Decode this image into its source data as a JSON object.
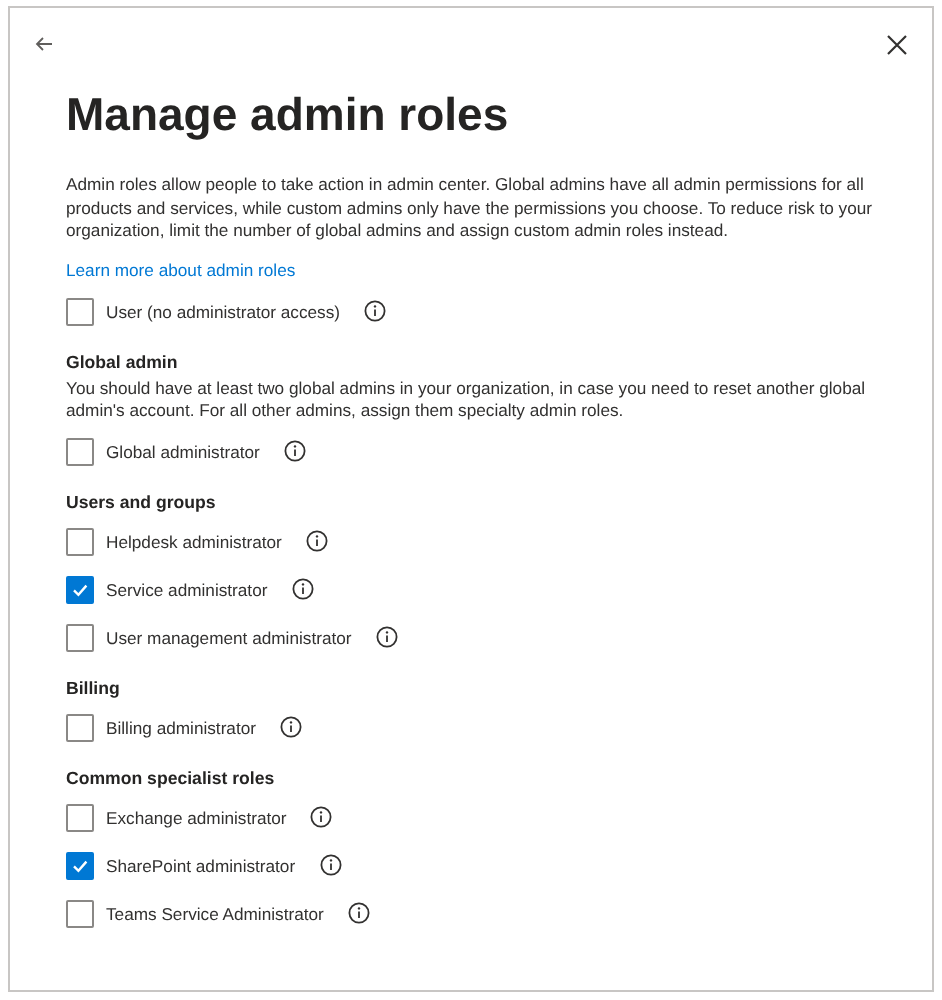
{
  "dialog": {
    "title": "Manage admin roles"
  },
  "intro": {
    "description": "Admin roles allow people to take action in admin center. Global admins have all admin permissions for all products and services, while custom admins only have the permissions you choose. To reduce risk to your organization, limit the number of global admins and assign custom admin roles instead.",
    "link": "Learn more about admin roles"
  },
  "options": [
    {
      "label": "User (no administrator access)",
      "checked": false
    }
  ],
  "sections": [
    {
      "heading": "Global admin",
      "description": "You should have at least two global admins in your organization, in case you need to reset another global admin's account. For all other admins, assign them specialty admin roles.",
      "options": [
        {
          "label": "Global administrator",
          "checked": false
        }
      ]
    },
    {
      "heading": "Users and groups",
      "options": [
        {
          "label": "Helpdesk administrator",
          "checked": false
        },
        {
          "label": "Service administrator",
          "checked": true
        },
        {
          "label": "User management administrator",
          "checked": false
        }
      ]
    },
    {
      "heading": "Billing",
      "options": [
        {
          "label": "Billing administrator",
          "checked": false
        }
      ]
    },
    {
      "heading": "Common specialist roles",
      "options": [
        {
          "label": "Exchange administrator",
          "checked": false
        },
        {
          "label": "SharePoint administrator",
          "checked": true
        },
        {
          "label": "Teams Service Administrator",
          "checked": false
        }
      ]
    }
  ]
}
